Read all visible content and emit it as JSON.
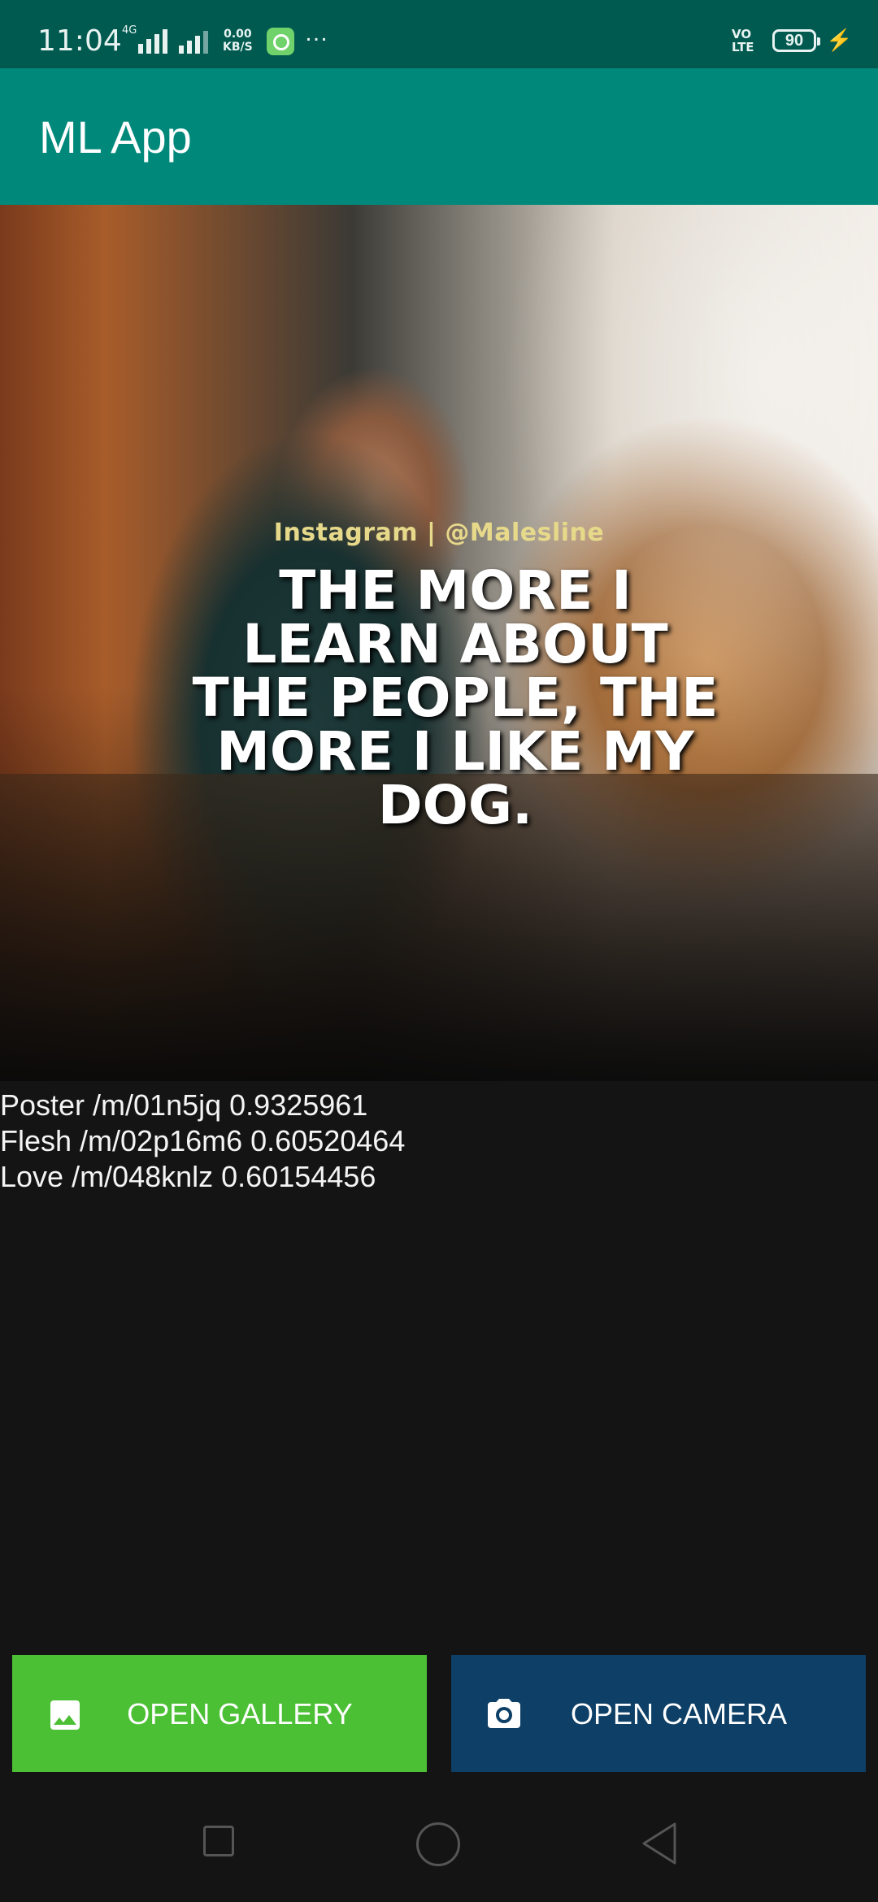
{
  "status_bar": {
    "time": "11:04",
    "network_tag": "4G",
    "speed_value": "0.00",
    "speed_unit": "KB/S",
    "overflow": "…",
    "volte_top": "VO",
    "volte_bottom": "LTE",
    "battery_level": "90"
  },
  "app_bar": {
    "title": "ML App"
  },
  "image": {
    "credit": "Instagram | @Malesline",
    "quote": "THE MORE I LEARN ABOUT THE PEOPLE, THE MORE I LIKE MY DOG."
  },
  "results": [
    "Poster /m/01n5jq 0.9325961",
    "Flesh /m/02p16m6 0.60520464",
    "Love /m/048knlz 0.60154456"
  ],
  "buttons": {
    "gallery_label": "OPEN GALLERY",
    "camera_label": "OPEN CAMERA",
    "gallery_color": "#4cc035",
    "camera_color": "#0e3f66"
  },
  "colors": {
    "status_bar": "#005a50",
    "app_bar": "#00897b",
    "background": "#141414"
  }
}
